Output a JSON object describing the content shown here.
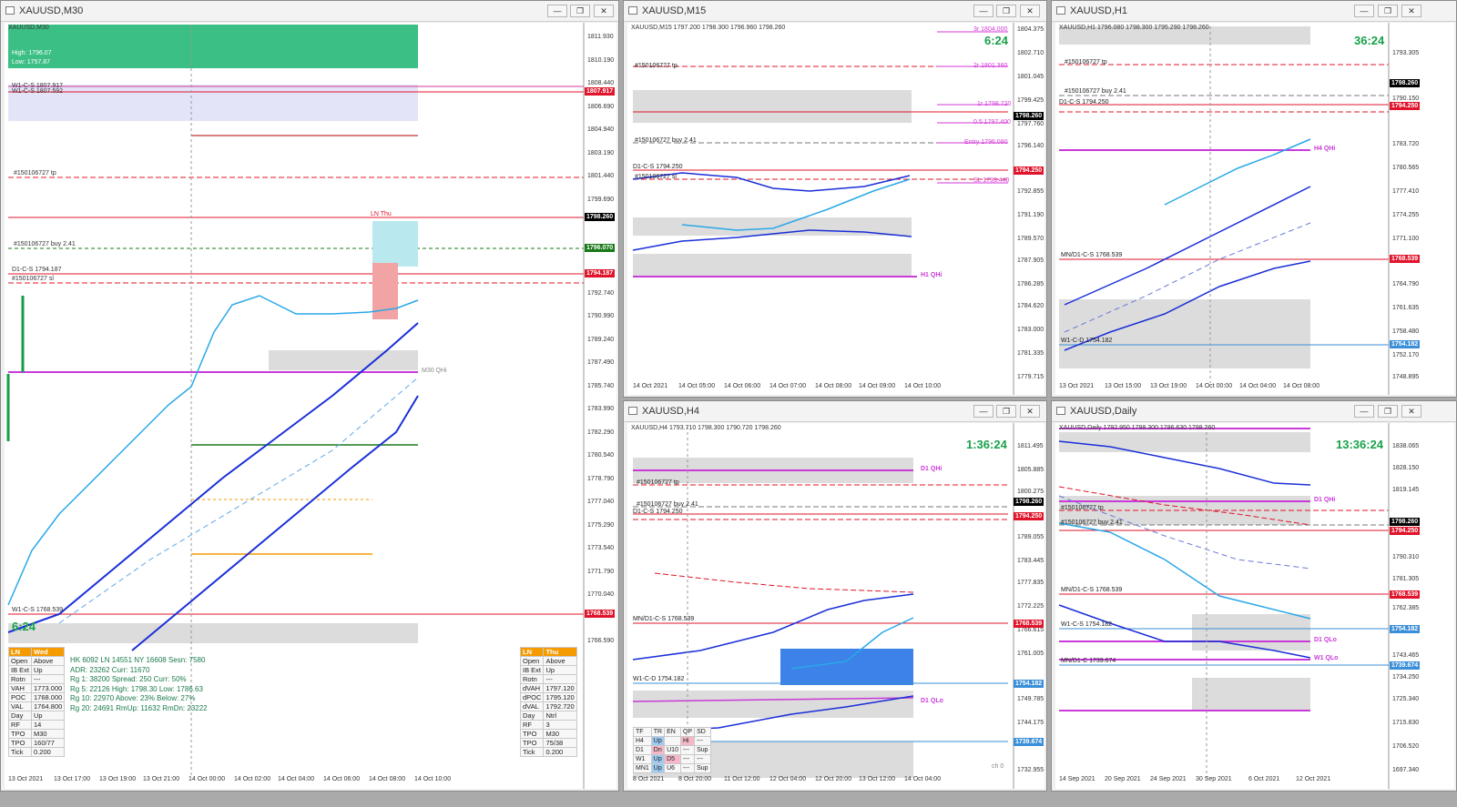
{
  "windows": {
    "m30": {
      "title": "XAUUSD,M30",
      "chart_title": "XAUUSD,M30",
      "timer": "6:24",
      "price_axis": [
        "1811.930",
        "1810.190",
        "1808.440",
        "1806.690",
        "1804.940",
        "1803.190",
        "1801.440",
        "1799.690",
        "1797.940",
        "1796.190",
        "1794.440",
        "1792.740",
        "1790.990",
        "1789.240",
        "1787.490",
        "1785.740",
        "1783.990",
        "1782.290",
        "1780.540",
        "1778.790",
        "1777.040",
        "1775.290",
        "1773.540",
        "1771.790",
        "1770.040",
        "1768.290",
        "1766.590"
      ],
      "time_axis": [
        "13 Oct 2021",
        "13 Oct 17:00",
        "13 Oct 19:00",
        "13 Oct 21:00",
        "14 Oct 00:00",
        "14 Oct 02:00",
        "14 Oct 04:00",
        "14 Oct 06:00",
        "14 Oct 08:00",
        "14 Oct 10:00"
      ],
      "tags": [
        {
          "text": "1807.917",
          "color": "#e0142a"
        },
        {
          "text": "1798.260",
          "color": "#000000"
        },
        {
          "text": "1796.070",
          "color": "#1a7a1a"
        },
        {
          "text": "1794.187",
          "color": "#e0142a"
        },
        {
          "text": "1768.539",
          "color": "#e0142a"
        }
      ],
      "labels": {
        "high": "High: 1796.07",
        "low": "Low: 1757.87",
        "w1cs": "W1-C-S 1807.917",
        "w1cs2": "W1-C-S 1807.592",
        "tp": "#150106727 tp",
        "buy": "#150106727 buy 2.41",
        "d1cs": "D1-C-S 1794.187",
        "sl": "#150106727 sl",
        "ln_thu": "LN Thu",
        "m30_qhi": "M30 QHi",
        "w1cs_low": "W1-C-S 1768.539"
      },
      "left_table": {
        "header": [
          "LN",
          "Wed"
        ],
        "rows": [
          [
            "Open",
            "Above"
          ],
          [
            "IB Ext",
            "Up"
          ],
          [
            "Rotn",
            "---"
          ],
          [
            "VAH",
            "1773.000"
          ],
          [
            "POC",
            "1768.000"
          ],
          [
            "VAL",
            "1764.800"
          ],
          [
            "Day",
            "Up"
          ],
          [
            "RF",
            "14"
          ],
          [
            "TPO",
            "M30"
          ],
          [
            "TPO",
            "160/77"
          ],
          [
            "Tick",
            "0.200"
          ]
        ]
      },
      "info_lines": [
        "HK 6092  LN  14551  NY 16608   Sesn: 7580",
        "ADR:   23262   Curr:  11670",
        "Rg  1:  38200  Spread:  250     Curr:   50%",
        "Rg  5:  22126  High:  1798.30  Low:  1786.63",
        "Rg 10:  22970  Above:  23%     Below:  27%",
        "Rg 20:  24691  RmUp: 11632   RmDn: 23222"
      ],
      "right_table": {
        "header": [
          "LN",
          "Thu"
        ],
        "rows": [
          [
            "Open",
            "Above"
          ],
          [
            "IB Ext",
            "Up"
          ],
          [
            "Rotn",
            "---"
          ],
          [
            "dVAH",
            "1797.120"
          ],
          [
            "dPOC",
            "1795.120"
          ],
          [
            "dVAL",
            "1792.720"
          ],
          [
            "Day",
            "Ntrl"
          ],
          [
            "RF",
            "3"
          ],
          [
            "TPO",
            "M30"
          ],
          [
            "TPO",
            "75/38"
          ],
          [
            "Tick",
            "0.200"
          ]
        ]
      }
    },
    "m15": {
      "title": "XAUUSD,M15",
      "chart_title": "XAUUSD,M15  1797.200 1798.300 1796.960 1798.260",
      "timer": "6:24",
      "price_axis": [
        "1804.375",
        "1802.710",
        "1801.045",
        "1799.425",
        "1797.760",
        "1796.140",
        "1794.475",
        "1792.855",
        "1791.190",
        "1789.570",
        "1787.905",
        "1786.285",
        "1784.620",
        "1783.000",
        "1781.335",
        "1779.715"
      ],
      "time_axis": [
        "14 Oct 2021",
        "14 Oct 05:00",
        "14 Oct 06:00",
        "14 Oct 07:00",
        "14 Oct 08:00",
        "14 Oct 09:00",
        "14 Oct 10:00"
      ],
      "tags": [
        {
          "text": "1798.260",
          "color": "#000000"
        },
        {
          "text": "1794.250",
          "color": "#e0142a"
        }
      ],
      "labels": {
        "tp": "#150106727 tp",
        "buy": "#150106727 buy 2.41",
        "d1cs": "D1-C-S 1794.250",
        "sl": "#150106727 sl",
        "h1qhi": "H1 QHi",
        "fib3": "3r  1804.000",
        "fib2": "2r  1801.360",
        "fib1": "1r  1798.720",
        "fib05": "0.5  1797.400",
        "entry": "Entry  1796.080",
        "slf": "SL  1793.440"
      }
    },
    "h1": {
      "title": "XAUUSD,H1",
      "chart_title": "XAUUSD,H1  1796.080 1798.300 1795.290 1798.260",
      "timer": "36:24",
      "price_axis": [
        "1793.305",
        "1790.150",
        "1786.995",
        "1783.720",
        "1780.565",
        "1777.410",
        "1774.255",
        "1771.100",
        "1767.945",
        "1764.790",
        "1761.635",
        "1758.480",
        "1755.325",
        "1752.170",
        "1748.895"
      ],
      "time_axis": [
        "13 Oct 2021",
        "13 Oct 15:00",
        "13 Oct 19:00",
        "14 Oct 00:00",
        "14 Oct 04:00",
        "14 Oct 08:00"
      ],
      "tags": [
        {
          "text": "1798.260",
          "color": "#000000"
        },
        {
          "text": "1794.250",
          "color": "#e0142a"
        },
        {
          "text": "1768.539",
          "color": "#e0142a"
        },
        {
          "text": "1754.182",
          "color": "#3a8fd8"
        }
      ],
      "labels": {
        "tp": "#150106727 tp",
        "buy": "#150106727 buy 2.41",
        "d1cs": "D1-C-S 1794.250",
        "h4qhi": "H4 QHi",
        "mnd": "MN/D1-C-S 1768.539",
        "w1cd": "W1-C-D 1754.182"
      }
    },
    "h4": {
      "title": "XAUUSD,H4",
      "chart_title": "XAUUSD,H4  1793.710 1798.300 1790.720 1798.260",
      "timer": "1:36:24",
      "price_axis": [
        "1811.495",
        "1805.885",
        "1800.275",
        "1794.665",
        "1789.055",
        "1783.445",
        "1777.835",
        "1772.225",
        "1766.615",
        "1761.005",
        "1755.395",
        "1749.785",
        "1744.175",
        "1738.565",
        "1732.955"
      ],
      "time_axis": [
        "8 Oct 2021",
        "8 Oct 20:00",
        "11 Oct 12:00",
        "12 Oct 04:00",
        "12 Oct 20:00",
        "13 Oct 12:00",
        "14 Oct 04:00"
      ],
      "tags": [
        {
          "text": "1798.260",
          "color": "#000000"
        },
        {
          "text": "1794.250",
          "color": "#e0142a"
        },
        {
          "text": "1768.539",
          "color": "#e0142a"
        },
        {
          "text": "1754.182",
          "color": "#3a8fd8"
        },
        {
          "text": "1739.674",
          "color": "#3a8fd8"
        }
      ],
      "labels": {
        "d1qhi": "D1 QHi",
        "tp": "#150106727 tp",
        "buy": "#150106727 buy 2.41",
        "d1cs": "D1-C-S 1794.250",
        "mnd": "MN/D1-C-S 1768.539",
        "w1cd": "W1-C-D 1754.182",
        "d1qlo": "D1 QLo",
        "ch": "ch 0"
      },
      "tf_table": {
        "header": [
          "TF",
          "TR",
          "EN",
          "QP",
          "SD"
        ],
        "rows": [
          [
            "H4",
            "Up",
            "",
            "Hi",
            "---"
          ],
          [
            "D1",
            "Dn",
            "U10",
            "---",
            "Sup"
          ],
          [
            "W1",
            "Up",
            "D5",
            "---",
            "---"
          ],
          [
            "MN1",
            "Up",
            "U6",
            "---",
            "Sup"
          ]
        ]
      }
    },
    "daily": {
      "title": "XAUUSD,Daily",
      "chart_title": "XAUUSD,Daily  1792.950 1798.300 1786.630 1798.260",
      "timer": "13:36:24",
      "price_axis": [
        "1838.065",
        "1828.150",
        "1819.145",
        "1809.230",
        "1800.225",
        "1790.310",
        "1781.305",
        "1771.390",
        "1762.385",
        "1752.470",
        "1743.465",
        "1734.250",
        "1725.340",
        "1715.830",
        "1706.520",
        "1697.340"
      ],
      "time_axis": [
        "14 Sep 2021",
        "20 Sep 2021",
        "24 Sep 2021",
        "30 Sep 2021",
        "6 Oct 2021",
        "12 Oct 2021"
      ],
      "tags": [
        {
          "text": "1798.260",
          "color": "#000000"
        },
        {
          "text": "1794.250",
          "color": "#e0142a"
        },
        {
          "text": "1768.539",
          "color": "#e0142a"
        },
        {
          "text": "1754.182",
          "color": "#3a8fd8"
        },
        {
          "text": "1739.674",
          "color": "#3a8fd8"
        }
      ],
      "labels": {
        "d1qhi": "D1 QHi",
        "tp": "#150106727 tp",
        "buy": "#150106727 buy 2.41",
        "mnd": "MN/D1-C-S 1768.539",
        "w1c": "W1-C-S 1754.182",
        "mnd2": "MN/D1-C 1739.674",
        "d1qlo": "D1 QLo",
        "w1qlo": "W1 QLo"
      }
    }
  },
  "window_buttons": {
    "min": "—",
    "restore": "❐",
    "close": "✕"
  }
}
